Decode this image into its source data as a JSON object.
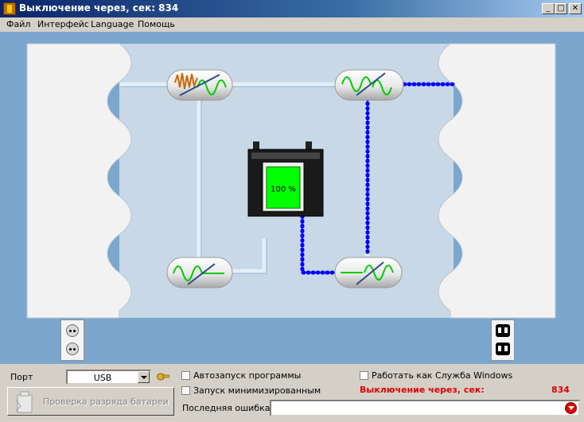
{
  "window": {
    "title": "Выключение через, сек: 834"
  },
  "menu": {
    "items": [
      "Файл",
      "Интерфейс",
      "Language",
      "Помощь"
    ]
  },
  "battery": {
    "charge_label": "100 %",
    "charge_level": 1.0,
    "fill_color": "#00ff00"
  },
  "colors": {
    "canvas_bg": "#7ba6cd",
    "panel_bg": "#c8d8e6",
    "active_line": "#0000ff",
    "wave": "#00cc00",
    "alert": "#e00000"
  },
  "icons": {
    "inlet": "wall-socket-icon",
    "outlets": "power-outlet-icon",
    "port_config": "settings-key-icon",
    "error": "error-dropdown-icon"
  },
  "controls": {
    "port_label": "Порт",
    "port_value": "USB",
    "test_button": "Проверка разряда батареи",
    "autostart": {
      "label": "Автозапуск программы",
      "checked": false
    },
    "start_minimized": {
      "label": "Запуск минимизированным",
      "checked": false
    },
    "run_as_service": {
      "label": "Работать как Служба Windows",
      "checked": false
    },
    "shutdown_label": "Выключение через, сек:",
    "shutdown_value": "834",
    "last_error_label": "Последняя ошибка",
    "last_error_value": ""
  }
}
